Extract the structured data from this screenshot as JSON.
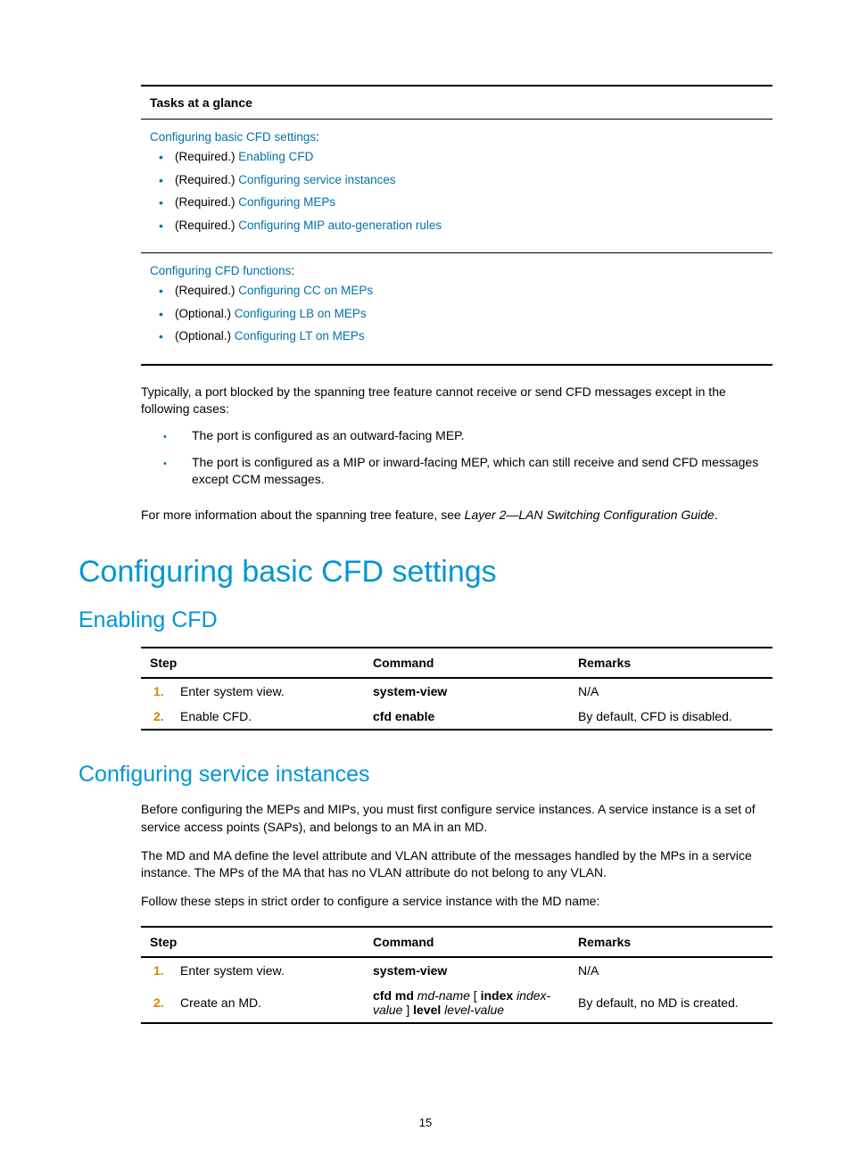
{
  "tasks_table": {
    "header": "Tasks at a glance",
    "section1": {
      "title_link": "Configuring basic CFD settings",
      "colon": ":",
      "items": [
        {
          "prefix": "(Required.) ",
          "link": "Enabling CFD"
        },
        {
          "prefix": "(Required.) ",
          "link": "Configuring service instances"
        },
        {
          "prefix": "(Required.) ",
          "link": "Configuring MEPs"
        },
        {
          "prefix": "(Required.) ",
          "link": "Configuring MIP auto-generation rules"
        }
      ]
    },
    "section2": {
      "title_link": "Configuring CFD functions",
      "colon": ":",
      "items": [
        {
          "prefix": "(Required.) ",
          "link": "Configuring CC on MEPs"
        },
        {
          "prefix": "(Optional.) ",
          "link": "Configuring LB on MEPs"
        },
        {
          "prefix": "(Optional.) ",
          "link": "Configuring LT on MEPs"
        }
      ]
    }
  },
  "para1": "Typically, a port blocked by the spanning tree feature cannot receive or send CFD messages except in the following cases:",
  "bullets1": [
    "The port is configured as an outward-facing MEP.",
    "The port is configured as a MIP or inward-facing MEP, which can still receive and send CFD messages except CCM messages."
  ],
  "para2_pre": "For more information about the spanning tree feature, see ",
  "para2_ital": "Layer 2—LAN Switching Configuration Guide",
  "para2_post": ".",
  "h1_1": "Configuring basic CFD settings",
  "h2_1": "Enabling CFD",
  "table1": {
    "h_step": "Step",
    "h_cmd": "Command",
    "h_rem": "Remarks",
    "rows": [
      {
        "num": "1.",
        "step": "Enter system view.",
        "cmd": "system-view",
        "rem": "N/A"
      },
      {
        "num": "2.",
        "step": "Enable CFD.",
        "cmd": "cfd enable",
        "rem": "By default, CFD is disabled."
      }
    ]
  },
  "h2_2": "Configuring service instances",
  "para3": "Before configuring the MEPs and MIPs, you must first configure service instances. A service instance is a set of service access points (SAPs), and belongs to an MA in an MD.",
  "para4": "The MD and MA define the level attribute and VLAN attribute of the messages handled by the MPs in a service instance. The MPs of the MA that has no VLAN attribute do not belong to any VLAN.",
  "para5": "Follow these steps in strict order to configure a service instance with the MD name:",
  "table2": {
    "h_step": "Step",
    "h_cmd": "Command",
    "h_rem": "Remarks",
    "rows": [
      {
        "num": "1.",
        "step": "Enter system view.",
        "cmd_parts": [
          {
            "b": "system-view"
          }
        ],
        "rem": "N/A"
      },
      {
        "num": "2.",
        "step": "Create an MD.",
        "cmd_parts": [
          {
            "b": "cfd md "
          },
          {
            "i": "md-name"
          },
          {
            "t": " [ "
          },
          {
            "b": "index"
          },
          {
            "t": " "
          },
          {
            "i": "index-value"
          },
          {
            "t": " ] "
          },
          {
            "b": "level"
          },
          {
            "t": " "
          },
          {
            "i": "level-value"
          }
        ],
        "rem": "By default, no MD is created."
      }
    ]
  },
  "page_number": "15"
}
